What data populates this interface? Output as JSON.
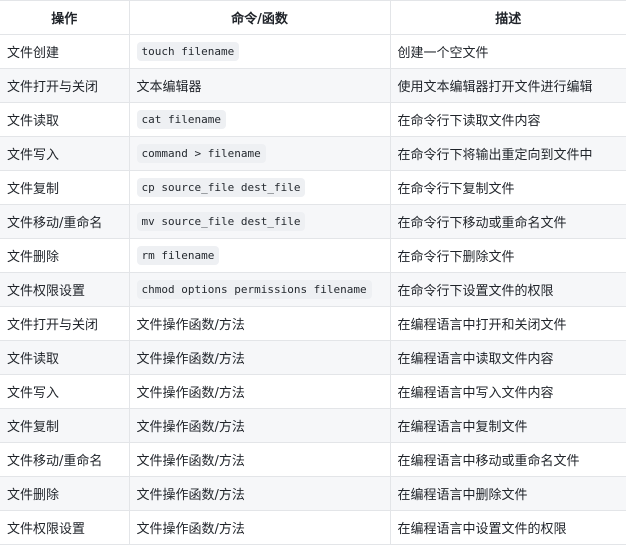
{
  "headers": [
    "操作",
    "命令/函数",
    "描述"
  ],
  "rows": [
    {
      "op": "文件创建",
      "cmd": "touch filename",
      "code": true,
      "desc": "创建一个空文件"
    },
    {
      "op": "文件打开与关闭",
      "cmd": "文本编辑器",
      "code": false,
      "desc": "使用文本编辑器打开文件进行编辑"
    },
    {
      "op": "文件读取",
      "cmd": "cat filename",
      "code": true,
      "desc": "在命令行下读取文件内容"
    },
    {
      "op": "文件写入",
      "cmd": "command > filename",
      "code": true,
      "desc": "在命令行下将输出重定向到文件中"
    },
    {
      "op": "文件复制",
      "cmd": "cp source_file dest_file",
      "code": true,
      "desc": "在命令行下复制文件"
    },
    {
      "op": "文件移动/重命名",
      "cmd": "mv source_file dest_file",
      "code": true,
      "desc": "在命令行下移动或重命名文件"
    },
    {
      "op": "文件删除",
      "cmd": "rm filename",
      "code": true,
      "desc": "在命令行下删除文件"
    },
    {
      "op": "文件权限设置",
      "cmd": "chmod options permissions filename",
      "code": true,
      "desc": "在命令行下设置文件的权限"
    },
    {
      "op": "文件打开与关闭",
      "cmd": "文件操作函数/方法",
      "code": false,
      "desc": "在编程语言中打开和关闭文件"
    },
    {
      "op": "文件读取",
      "cmd": "文件操作函数/方法",
      "code": false,
      "desc": "在编程语言中读取文件内容"
    },
    {
      "op": "文件写入",
      "cmd": "文件操作函数/方法",
      "code": false,
      "desc": "在编程语言中写入文件内容"
    },
    {
      "op": "文件复制",
      "cmd": "文件操作函数/方法",
      "code": false,
      "desc": "在编程语言中复制文件"
    },
    {
      "op": "文件移动/重命名",
      "cmd": "文件操作函数/方法",
      "code": false,
      "desc": "在编程语言中移动或重命名文件"
    },
    {
      "op": "文件删除",
      "cmd": "文件操作函数/方法",
      "code": false,
      "desc": "在编程语言中删除文件"
    },
    {
      "op": "文件权限设置",
      "cmd": "文件操作函数/方法",
      "code": false,
      "desc": "在编程语言中设置文件的权限"
    }
  ]
}
